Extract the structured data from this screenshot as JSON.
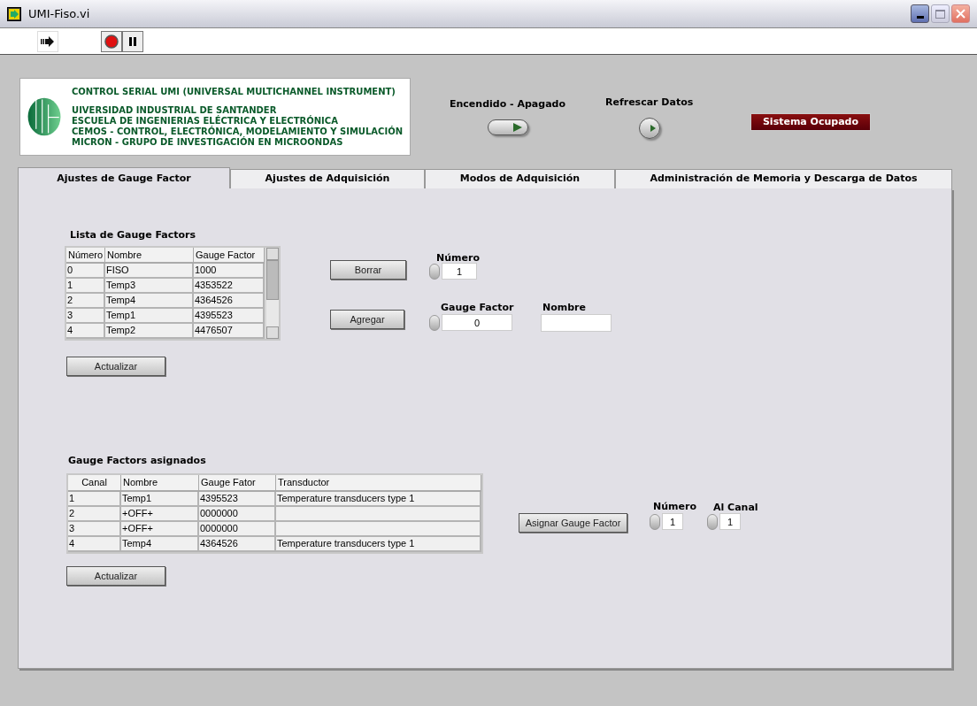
{
  "window": {
    "title": "UMI-Fiso.vi"
  },
  "banner": {
    "title": "CONTROL SERIAL UMI (UNIVERSAL MULTICHANNEL INSTRUMENT)",
    "lines": [
      "UIVERSIDAD INDUSTRIAL DE SANTANDER",
      "ESCUELA DE INGENIERIAS ELÉCTRICA Y ELECTRÓNICA",
      "CEMOS - CONTROL, ELECTRÓNICA, MODELAMIENTO Y SIMULACIÓN",
      "MICRON - GRUPO DE INVESTIGACIÓN EN MICROONDAS"
    ]
  },
  "power": {
    "label": "Encendido - Apagado",
    "on": true
  },
  "refresh": {
    "label": "Refrescar Datos"
  },
  "busy": {
    "label": "Sistema Ocupado"
  },
  "tabs": [
    {
      "label": "Ajustes de Gauge Factor",
      "selected": true
    },
    {
      "label": "Ajustes de Adquisición",
      "selected": false
    },
    {
      "label": "Modos de Adquisición",
      "selected": false
    },
    {
      "label": "Administración de Memoria y Descarga de Datos",
      "selected": false
    }
  ],
  "gauge_list": {
    "title": "Lista de Gauge Factors",
    "columns": [
      "Número",
      "Nombre",
      "Gauge Factor"
    ],
    "rows": [
      [
        "0",
        "FISO",
        "1000"
      ],
      [
        "1",
        "Temp3",
        "4353522"
      ],
      [
        "2",
        "Temp4",
        "4364526"
      ],
      [
        "3",
        "Temp1",
        "4395523"
      ],
      [
        "4",
        "Temp2",
        "4476507"
      ]
    ],
    "update_button": "Actualizar"
  },
  "editor": {
    "delete_button": "Borrar",
    "add_button": "Agregar",
    "number": {
      "label": "Número",
      "value": "1"
    },
    "gauge_factor": {
      "label": "Gauge Factor",
      "value": "0"
    },
    "name": {
      "label": "Nombre"
    }
  },
  "assigned": {
    "title": "Gauge Factors asignados",
    "columns": [
      "Canal",
      "Nombre",
      "Gauge Fator",
      "Transductor"
    ],
    "rows": [
      [
        "1",
        "Temp1",
        "4395523",
        "Temperature transducers type 1"
      ],
      [
        "2",
        "+OFF+",
        "0000000"
      ],
      [
        "3",
        "+OFF+",
        "0000000"
      ],
      [
        "4",
        "Temp4",
        "4364526",
        "Temperature transducers type 1"
      ]
    ],
    "update_button": "Actualizar"
  },
  "assign": {
    "button": "Asignar Gauge Factor",
    "number": {
      "label": "Número",
      "value": "1"
    },
    "channel": {
      "label": "Al Canal",
      "value": "1"
    }
  }
}
